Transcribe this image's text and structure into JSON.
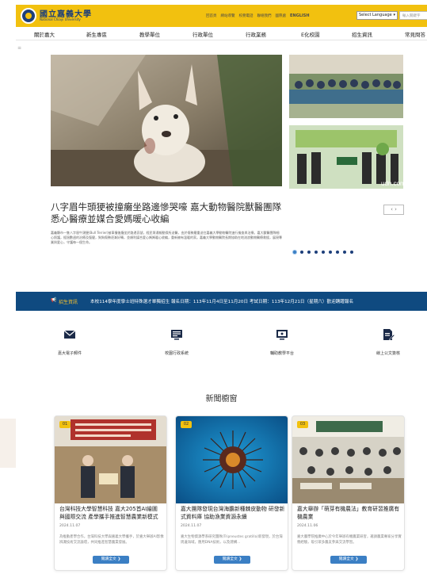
{
  "header": {
    "brand": "國立嘉義大學",
    "brand_en": "National Chiayi University",
    "toplinks": [
      "回首頁",
      "網站導覽",
      "校務電話",
      "聯絡我們",
      "國際處",
      "ENGLISH"
    ],
    "language_select": "Select Language",
    "search_placeholder": "輸入關鍵字"
  },
  "nav": [
    "關於嘉大",
    "新生專區",
    "教學單位",
    "行政單位",
    "行政業務",
    "E化校園",
    "招生資訊",
    "常見問答"
  ],
  "hero": {
    "title": "八字眉牛頭㹴被撞癱坐路邊慘哭嚎 嘉大動物醫院獸醫團隊悉心醫療並媒合愛媽暖心收編",
    "desc": "嘉義縣市一隻八字眉牛頭㹴(Bull Terrier)被車撞後癱坐於路邊哀號，經民眾通報動保所送醫，由於傷勢嚴重送往嘉義大學動物醫院進行檢查與治療。嘉大獸醫團隊細心照護，經過數週的治療及復健，狗狗傷勢逐漸好轉，並順利媒合愛心媽媽暖心收編，重新擁有溫暖的家。嘉義大學動物醫院長期協助在地流浪動物醫療救援，展現專業與愛心，守護每一個生命。",
    "pager": "‹ ›",
    "dot_count": 9,
    "active_dot": 0,
    "watermark": "udn.com"
  },
  "ticker": {
    "label": "招生資訊",
    "text": "本校114學年度學士班特殊選才單獨招生 報名日期：113年11月4日至11月20日 考試日期：113年12月21日（星期六）歡迎踴躍報名"
  },
  "shortcuts": [
    {
      "label": "嘉大電子郵件",
      "icon": "mail-icon"
    },
    {
      "label": "校園行政系統",
      "icon": "document-screen-icon"
    },
    {
      "label": "輔助教學平台",
      "icon": "monitor-icon"
    },
    {
      "label": "線上公文簽核",
      "icon": "pen-document-icon"
    }
  ],
  "news": {
    "heading": "新聞櫥窗",
    "more_label": "閱讀全文 ❯",
    "items": [
      {
        "num": "01",
        "title": "台灣科技大學智慧科技 嘉大205首AI繪圖 與國際交流 產學攜手推進智慧農業新模式",
        "date": "2024.11.07",
        "summary": "為推動產學合作，台灣科技大學與嘉義大學攜手，於嘉大舉辦AI影像辨識技術交流論壇，共同推進智慧農業發展。"
      },
      {
        "num": "02",
        "title": "嘉大團隊發現台灣海膽新種棘皮動物 研發新式資料庫 協助漁業資源永續",
        "date": "2024.11.07",
        "summary": "嘉大生物資源學系研究團隊(Tripneustes gratilla)新發現，於台灣周邊海域，應用DNA技術，以及建構..."
      },
      {
        "num": "03",
        "title": "嘉大舉辦「萌芽有機農法」教育研習推廣有機農業",
        "date": "2024.11.06",
        "summary": "嘉大農學院推廣中心於今年舉辦有機農業研習，邀請農業專家分享實務經驗，吸引眾多農友參與交流學習。"
      }
    ]
  }
}
